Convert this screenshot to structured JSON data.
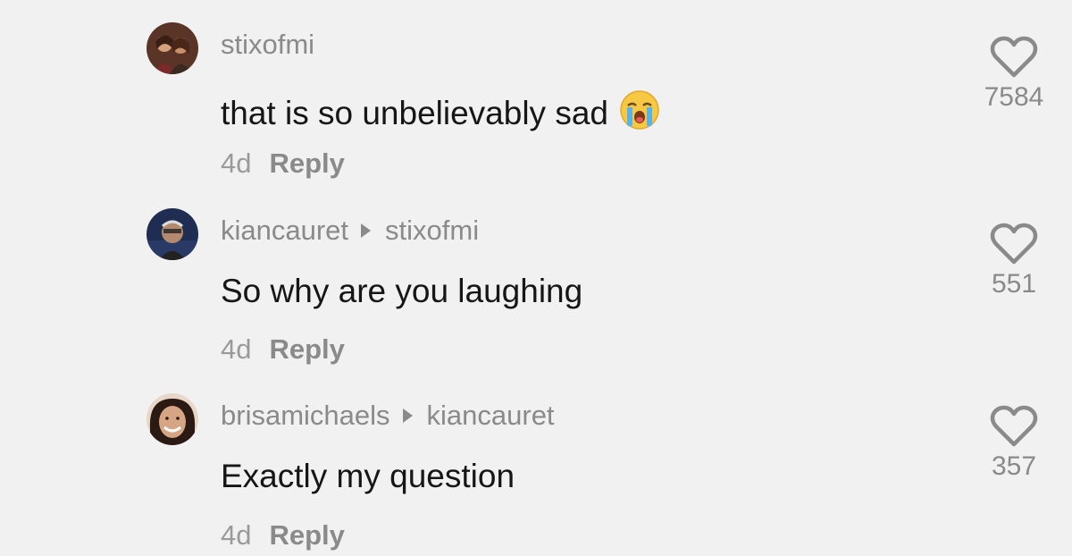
{
  "comments": [
    {
      "username": "stixofmi",
      "reply_to": "",
      "text": "that is so unbelievably sad",
      "emoji": "loudly-crying-face",
      "time": "4d",
      "reply_label": "Reply",
      "likes": "7584",
      "avatar_colors": [
        "#6b3a2c",
        "#c98f6a"
      ]
    },
    {
      "username": "kiancauret",
      "reply_to": "stixofmi",
      "text": "So why are you laughing",
      "emoji": "",
      "time": "4d",
      "reply_label": "Reply",
      "likes": "551",
      "avatar_colors": [
        "#1d2a4a",
        "#b48a6e"
      ]
    },
    {
      "username": "brisamichaels",
      "reply_to": "kiancauret",
      "text": "Exactly my question",
      "emoji": "",
      "time": "4d",
      "reply_label": "Reply",
      "likes": "357",
      "avatar_colors": [
        "#2b1a14",
        "#d6a584"
      ]
    }
  ],
  "icons": {
    "like": "heart-outline-icon",
    "reply_arrow": "triangle-right-icon"
  },
  "colors": {
    "background": "#f1f1f1",
    "text": "#161616",
    "secondary": "#8a8a8a"
  }
}
